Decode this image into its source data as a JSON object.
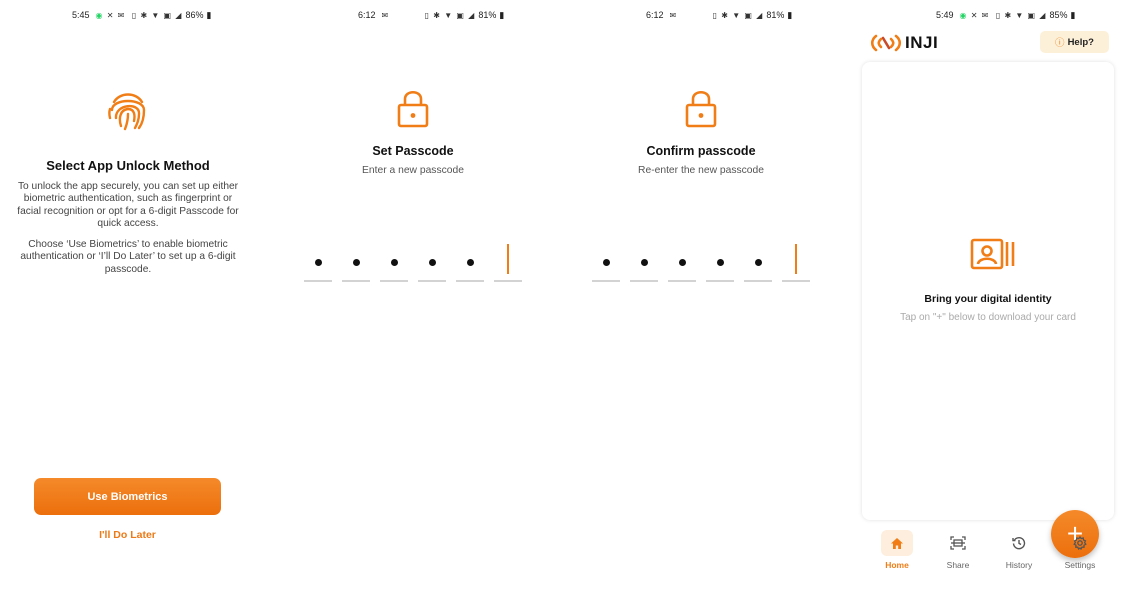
{
  "colors": {
    "accent": "#f07d16",
    "help_bg": "#fdf0d9",
    "nav_active_bg": "#fdeedd"
  },
  "screens": {
    "unlock": {
      "status": {
        "time": "5:45",
        "battery": "86%"
      },
      "title": "Select App Unlock Method",
      "body1": "To unlock the app securely, you can set up either biometric authentication, such as fingerprint or facial recognition or opt for a 6-digit Passcode for quick access.",
      "body2": "Choose ‘Use Biometrics’ to enable biometric authentication or ‘I’ll Do Later’ to set up a 6-digit passcode.",
      "primary_button": "Use Biometrics",
      "secondary_button": "I'll Do Later",
      "icon": "fingerprint-icon"
    },
    "set_passcode": {
      "status": {
        "time": "6:12",
        "battery": "81%"
      },
      "title": "Set Passcode",
      "subtitle": "Enter a new passcode",
      "filled_digits": 5,
      "total_digits": 6,
      "icon": "lock-icon"
    },
    "confirm_passcode": {
      "status": {
        "time": "6:12",
        "battery": "81%"
      },
      "title": "Confirm passcode",
      "subtitle": "Re-enter the new passcode",
      "filled_digits": 5,
      "total_digits": 6,
      "icon": "lock-icon"
    },
    "home": {
      "status": {
        "time": "5:49",
        "battery": "85%"
      },
      "logo_text": "INJI",
      "help_label": "Help?",
      "empty_title": "Bring your digital identity",
      "empty_subtitle": "Tap on  \"+\" below to download your card",
      "fab_label": "+",
      "nav": [
        {
          "label": "Home",
          "icon": "home-icon",
          "active": true
        },
        {
          "label": "Share",
          "icon": "scan-icon",
          "active": false
        },
        {
          "label": "History",
          "icon": "history-icon",
          "active": false
        },
        {
          "label": "Settings",
          "icon": "gear-icon",
          "active": false
        }
      ]
    }
  }
}
